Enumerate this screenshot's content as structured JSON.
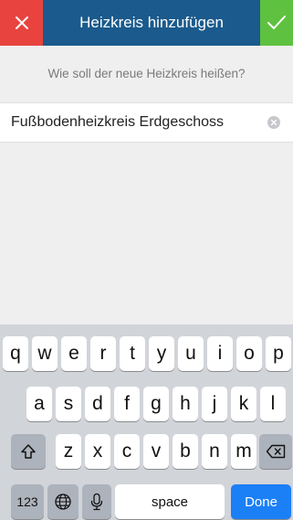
{
  "header": {
    "title": "Heizkreis hinzufügen",
    "cancel_icon": "close-icon",
    "confirm_icon": "checkmark-icon",
    "cancel_color": "#e8433f",
    "confirm_color": "#5ec13f",
    "bar_color": "#1b5a8c"
  },
  "form": {
    "prompt": "Wie soll der neue Heizkreis heißen?",
    "name_value": "Fußbodenheizkreis Erdgeschoss",
    "clear_icon": "clear-icon"
  },
  "keyboard": {
    "row1": [
      "q",
      "w",
      "e",
      "r",
      "t",
      "y",
      "u",
      "i",
      "o",
      "p"
    ],
    "row2": [
      "a",
      "s",
      "d",
      "f",
      "g",
      "h",
      "j",
      "k",
      "l"
    ],
    "row3": [
      "z",
      "x",
      "c",
      "v",
      "b",
      "n",
      "m"
    ],
    "numbers_label": "123",
    "space_label": "space",
    "done_label": "Done",
    "shift_icon": "shift-icon",
    "globe_icon": "globe-icon",
    "mic_icon": "microphone-icon",
    "backspace_icon": "backspace-icon",
    "done_color": "#1b7ff6"
  }
}
